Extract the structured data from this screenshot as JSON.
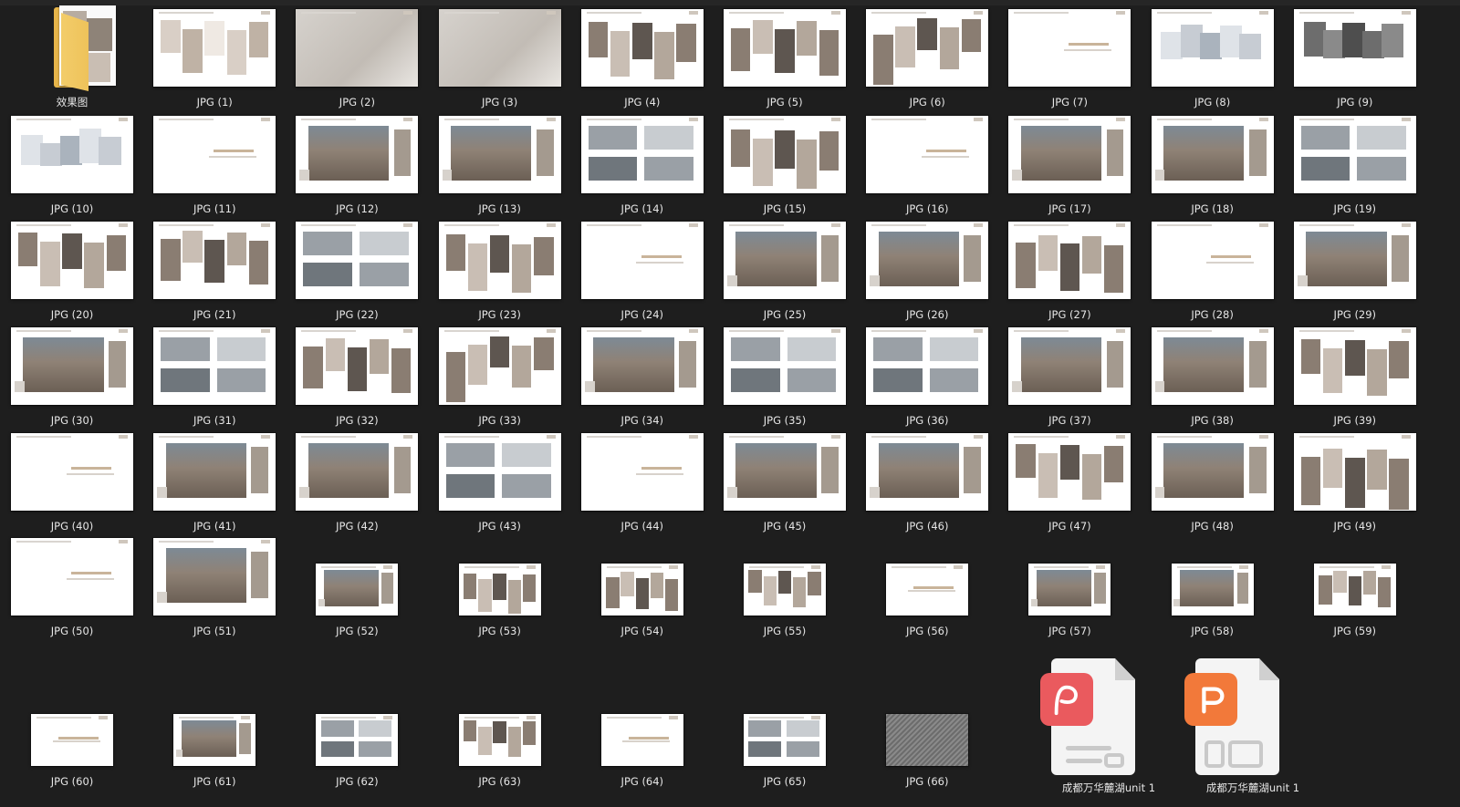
{
  "folder": {
    "label": "效果图"
  },
  "files": [
    {
      "label": "JPG (1)",
      "kind": "photo",
      "small": false
    },
    {
      "label": "JPG (2)",
      "kind": "image-full",
      "small": false
    },
    {
      "label": "JPG (3)",
      "kind": "image-full",
      "small": false
    },
    {
      "label": "JPG (4)",
      "kind": "collage",
      "small": false
    },
    {
      "label": "JPG (5)",
      "kind": "collage",
      "small": false
    },
    {
      "label": "JPG (6)",
      "kind": "collage",
      "small": false
    },
    {
      "label": "JPG (7)",
      "kind": "title",
      "small": false
    },
    {
      "label": "JPG (8)",
      "kind": "plan",
      "small": false
    },
    {
      "label": "JPG (9)",
      "kind": "model",
      "small": false
    },
    {
      "label": "JPG (10)",
      "kind": "plan",
      "small": false
    },
    {
      "label": "JPG (11)",
      "kind": "title",
      "small": false
    },
    {
      "label": "JPG (12)",
      "kind": "render",
      "small": false
    },
    {
      "label": "JPG (13)",
      "kind": "render",
      "small": false
    },
    {
      "label": "JPG (14)",
      "kind": "elevation",
      "small": false
    },
    {
      "label": "JPG (15)",
      "kind": "collage",
      "small": false
    },
    {
      "label": "JPG (16)",
      "kind": "title",
      "small": false
    },
    {
      "label": "JPG (17)",
      "kind": "render",
      "small": false
    },
    {
      "label": "JPG (18)",
      "kind": "render",
      "small": false
    },
    {
      "label": "JPG (19)",
      "kind": "elevation",
      "small": false
    },
    {
      "label": "JPG (20)",
      "kind": "collage",
      "small": false
    },
    {
      "label": "JPG (21)",
      "kind": "collage",
      "small": false
    },
    {
      "label": "JPG (22)",
      "kind": "elevation",
      "small": false
    },
    {
      "label": "JPG (23)",
      "kind": "collage",
      "small": false
    },
    {
      "label": "JPG (24)",
      "kind": "title",
      "small": false
    },
    {
      "label": "JPG (25)",
      "kind": "render",
      "small": false
    },
    {
      "label": "JPG (26)",
      "kind": "render",
      "small": false
    },
    {
      "label": "JPG (27)",
      "kind": "collage",
      "small": false
    },
    {
      "label": "JPG (28)",
      "kind": "title",
      "small": false
    },
    {
      "label": "JPG (29)",
      "kind": "render",
      "small": false
    },
    {
      "label": "JPG (30)",
      "kind": "render",
      "small": false
    },
    {
      "label": "JPG (31)",
      "kind": "elevation",
      "small": false
    },
    {
      "label": "JPG (32)",
      "kind": "collage",
      "small": false
    },
    {
      "label": "JPG (33)",
      "kind": "collage",
      "small": false
    },
    {
      "label": "JPG (34)",
      "kind": "render",
      "small": false
    },
    {
      "label": "JPG (35)",
      "kind": "elevation",
      "small": false
    },
    {
      "label": "JPG (36)",
      "kind": "elevation",
      "small": false
    },
    {
      "label": "JPG (37)",
      "kind": "render",
      "small": false
    },
    {
      "label": "JPG (38)",
      "kind": "render",
      "small": false
    },
    {
      "label": "JPG (39)",
      "kind": "collage",
      "small": false
    },
    {
      "label": "JPG (40)",
      "kind": "title",
      "small": false
    },
    {
      "label": "JPG (41)",
      "kind": "render",
      "small": false
    },
    {
      "label": "JPG (42)",
      "kind": "render",
      "small": false
    },
    {
      "label": "JPG (43)",
      "kind": "elevation",
      "small": false
    },
    {
      "label": "JPG (44)",
      "kind": "title",
      "small": false
    },
    {
      "label": "JPG (45)",
      "kind": "render",
      "small": false
    },
    {
      "label": "JPG (46)",
      "kind": "render",
      "small": false
    },
    {
      "label": "JPG (47)",
      "kind": "collage",
      "small": false
    },
    {
      "label": "JPG (48)",
      "kind": "render",
      "small": false
    },
    {
      "label": "JPG (49)",
      "kind": "collage",
      "small": false
    },
    {
      "label": "JPG (50)",
      "kind": "title",
      "small": false
    },
    {
      "label": "JPG (51)",
      "kind": "render",
      "small": false
    },
    {
      "label": "JPG (52)",
      "kind": "render",
      "small": true
    },
    {
      "label": "JPG (53)",
      "kind": "collage",
      "small": true
    },
    {
      "label": "JPG (54)",
      "kind": "collage",
      "small": true
    },
    {
      "label": "JPG (55)",
      "kind": "collage",
      "small": true
    },
    {
      "label": "JPG (56)",
      "kind": "title",
      "small": true
    },
    {
      "label": "JPG (57)",
      "kind": "render",
      "small": true
    },
    {
      "label": "JPG (58)",
      "kind": "render",
      "small": true
    },
    {
      "label": "JPG (59)",
      "kind": "collage",
      "small": true
    },
    {
      "label": "JPG (60)",
      "kind": "title",
      "small": true
    },
    {
      "label": "JPG (61)",
      "kind": "render",
      "small": true
    },
    {
      "label": "JPG (62)",
      "kind": "elevation",
      "small": true
    },
    {
      "label": "JPG (63)",
      "kind": "collage",
      "small": true
    },
    {
      "label": "JPG (64)",
      "kind": "title",
      "small": true
    },
    {
      "label": "JPG (65)",
      "kind": "elevation",
      "small": true
    },
    {
      "label": "JPG (66)",
      "kind": "texture",
      "small": true
    }
  ],
  "documents": [
    {
      "label": "成都万华麓湖unit 1",
      "type": "pdf",
      "icon": "pdf-document-icon",
      "badge_color": "#ea5a5e"
    },
    {
      "label": "成都万华麓湖unit 1",
      "type": "ppt",
      "icon": "ppt-document-icon",
      "badge_color": "#f2793a"
    }
  ],
  "colors": {
    "background": "#1e1e1e",
    "label_text": "#e6e6e6",
    "folder": "#f0c55c"
  }
}
